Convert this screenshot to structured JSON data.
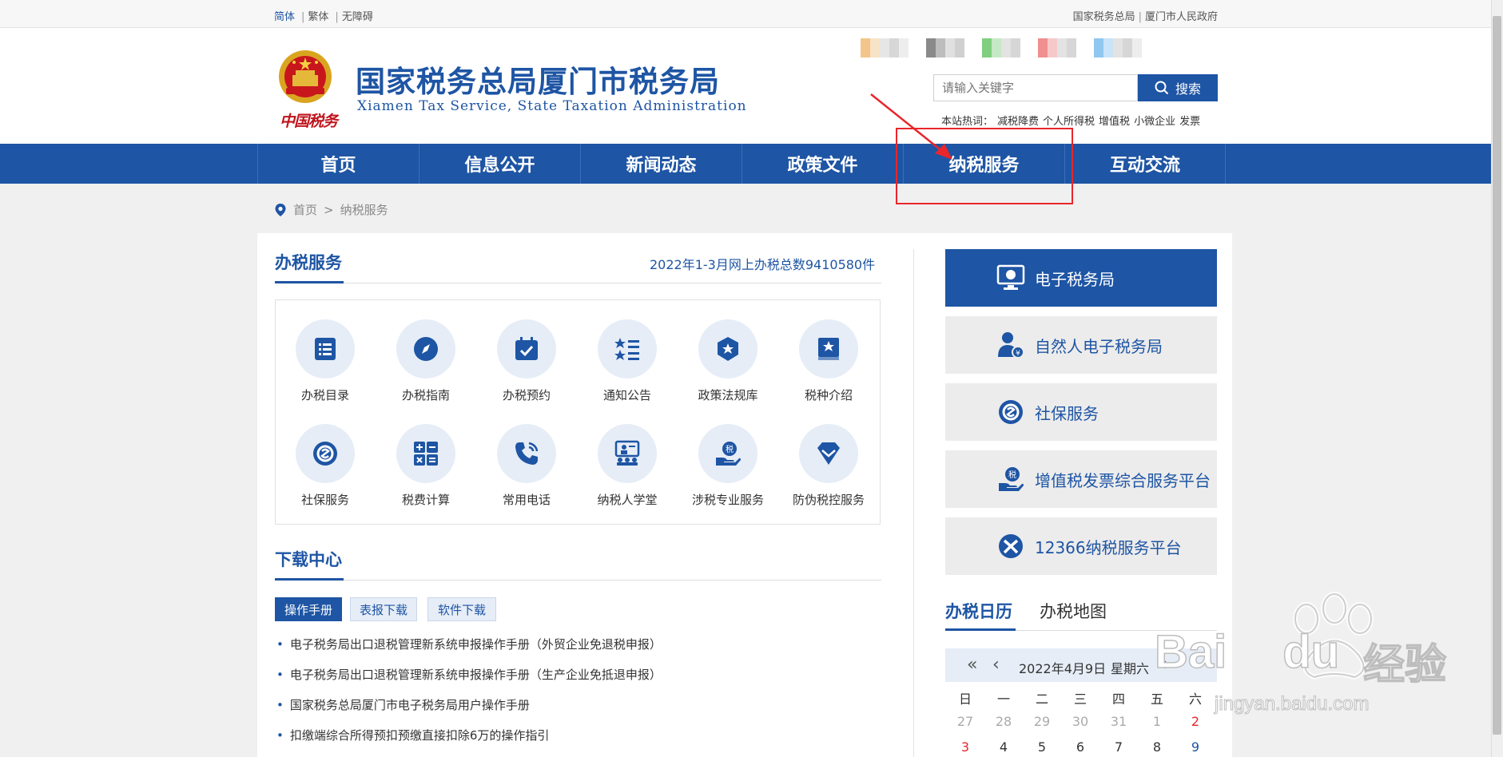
{
  "topbar": {
    "lang_simplified": "简体",
    "lang_traditional": "繁体",
    "accessibility": "无障碍",
    "link_state_tax": "国家税务总局",
    "link_city_gov": "厦门市人民政府"
  },
  "header": {
    "title_cn": "国家税务总局厦门市税务局",
    "title_en": "Xiamen Tax Service, State Taxation Administration",
    "logo_text": "中国税务",
    "search_placeholder": "请输入关键字",
    "search_button": "搜索",
    "hotwords_label": "本站热词：",
    "hotwords": [
      "减税降费",
      "个人所得税",
      "增值税",
      "小微企业",
      "发票"
    ]
  },
  "nav": {
    "items": [
      "首页",
      "信息公开",
      "新闻动态",
      "政策文件",
      "纳税服务",
      "互动交流"
    ]
  },
  "breadcrumb": {
    "home": "首页",
    "separator": ">",
    "current": "纳税服务"
  },
  "tax_services": {
    "title": "办税服务",
    "stats": "2022年1-3月网上办税总数9410580件",
    "items": [
      {
        "label": "办税目录",
        "icon": "list-icon"
      },
      {
        "label": "办税指南",
        "icon": "compass-icon"
      },
      {
        "label": "办税预约",
        "icon": "calendar-check-icon"
      },
      {
        "label": "通知公告",
        "icon": "star-list-icon"
      },
      {
        "label": "政策法规库",
        "icon": "shield-star-icon"
      },
      {
        "label": "税种介绍",
        "icon": "book-star-icon"
      },
      {
        "label": "社保服务",
        "icon": "social-security-icon"
      },
      {
        "label": "税费计算",
        "icon": "calculator-icon"
      },
      {
        "label": "常用电话",
        "icon": "phone-icon"
      },
      {
        "label": "纳税人学堂",
        "icon": "classroom-icon"
      },
      {
        "label": "涉税专业服务",
        "icon": "hand-coin-icon"
      },
      {
        "label": "防伪税控服务",
        "icon": "diamond-icon"
      }
    ]
  },
  "downloads": {
    "title": "下载中心",
    "tabs": [
      "操作手册",
      "表报下载",
      "软件下载"
    ],
    "items": [
      "电子税务局出口退税管理新系统申报操作手册（外贸企业免退税申报）",
      "电子税务局出口退税管理新系统申报操作手册（生产企业免抵退申报）",
      "国家税务总局厦门市电子税务局用户操作手册",
      "扣缴端综合所得预扣预缴直接扣除6万的操作指引"
    ]
  },
  "quick_links": [
    {
      "label": "电子税务局",
      "icon": "monitor-icon"
    },
    {
      "label": "自然人电子税务局",
      "icon": "person-icon"
    },
    {
      "label": "社保服务",
      "icon": "social-security-icon"
    },
    {
      "label": "增值税发票综合服务平台",
      "icon": "hand-coin-icon"
    },
    {
      "label": "12366纳税服务平台",
      "icon": "12366-logo-icon"
    }
  ],
  "calendar": {
    "tab_calendar": "办税日历",
    "tab_map": "办税地图",
    "date": "2022年4月9日",
    "weekday": "星期六",
    "prev_year": "«",
    "prev_month": "‹",
    "next_month": "›",
    "weekdays": [
      "日",
      "一",
      "二",
      "三",
      "四",
      "五",
      "六"
    ],
    "row1": [
      "27",
      "28",
      "29",
      "30",
      "31",
      "1",
      "2"
    ],
    "row2": [
      "3",
      "4",
      "5",
      "6",
      "7",
      "8",
      "9"
    ],
    "holiday_color": "#e8262b",
    "muted_color": "#aaaaaa"
  },
  "watermark": {
    "brand": "Bai",
    "brand2": "du",
    "cn": "经验",
    "url": "jingyan.baidu.com"
  },
  "colors": {
    "brand_blue": "#1e55a4",
    "annotation_red": "#e8262b"
  }
}
